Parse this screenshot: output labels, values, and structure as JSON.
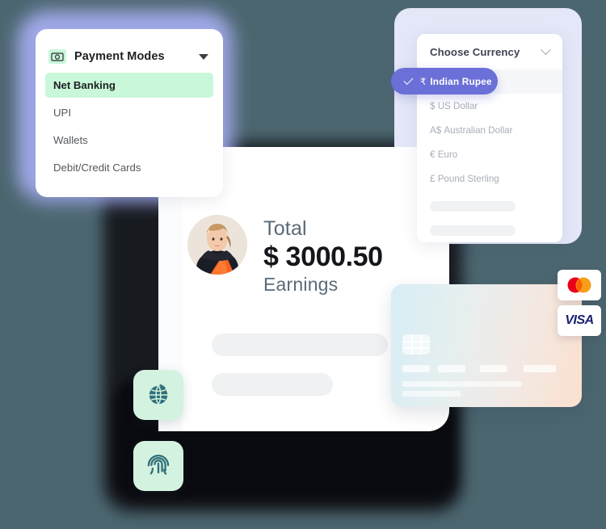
{
  "background_color": "#4c6670",
  "payment_modes": {
    "icon": "banknote-icon",
    "title": "Payment Modes",
    "caret": "chevron-down-icon",
    "items": [
      {
        "label": "Net Banking",
        "selected": true
      },
      {
        "label": "UPI",
        "selected": false
      },
      {
        "label": "Wallets",
        "selected": false
      },
      {
        "label": "Debit/Credit Cards",
        "selected": false
      }
    ],
    "highlight_color": "#c9f7d9"
  },
  "currency": {
    "header_label": "Choose Currency",
    "header_icon": "chevron-down-icon",
    "selected": {
      "symbol": "₹",
      "label": "Indian Rupee",
      "check_icon": "check-icon",
      "pill_color": "#6b6fd8"
    },
    "options": [
      {
        "symbol": "$",
        "label": "US Dollar"
      },
      {
        "symbol": "A$",
        "label": "Australian Dollar"
      },
      {
        "symbol": "€",
        "label": "Euro"
      },
      {
        "symbol": "£",
        "label": "Pound Sterling"
      }
    ],
    "panel_color": "#e4e7f7"
  },
  "earnings": {
    "avatar": "user-avatar",
    "label_top": "Total",
    "amount": "$ 3000.50",
    "label_bottom": "Earnings"
  },
  "credit_card": {
    "chip": "card-chip-icon",
    "gradient_from": "#d7eef4",
    "gradient_to": "#fbe0cf"
  },
  "brands": [
    {
      "name": "mastercard-logo",
      "label": ""
    },
    {
      "name": "visa-logo",
      "label": "VISA"
    }
  ],
  "feature_tiles": [
    {
      "icon": "globe-icon",
      "color": "#d4f2e0"
    },
    {
      "icon": "fingerprint-icon",
      "color": "#d4f2e0"
    }
  ]
}
